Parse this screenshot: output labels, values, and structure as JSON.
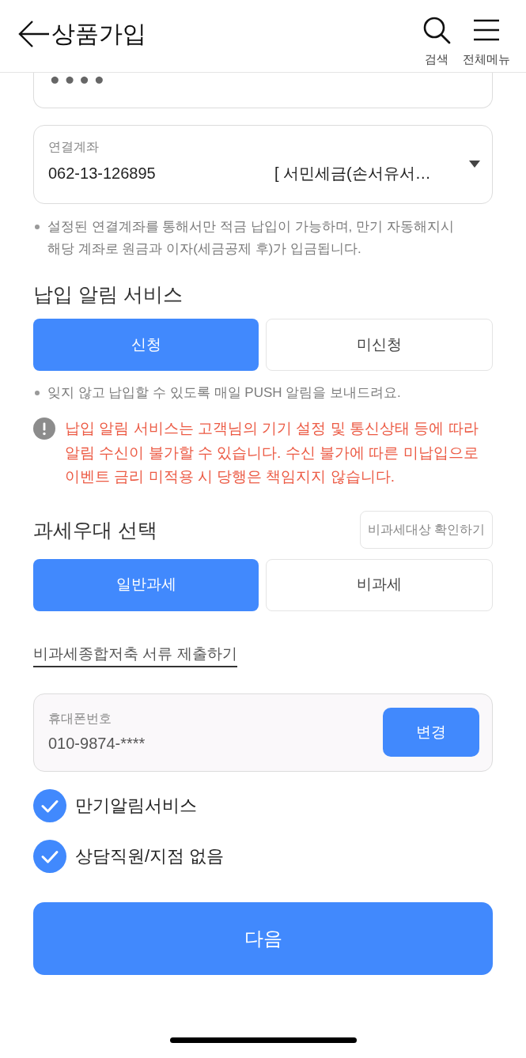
{
  "header": {
    "title": "상품가입",
    "actions": [
      {
        "kind": "search",
        "label": "검색"
      },
      {
        "kind": "menu",
        "label": "전체메뉴"
      }
    ]
  },
  "password_field": {
    "value": "●●●●"
  },
  "account_field": {
    "label": "연결계좌",
    "account_number": "062-13-126895",
    "account_name": "[ 서민세금(손서유서…"
  },
  "account_note": "설정된 연결계좌를 통해서만 적금 납입이 가능하며, 만기 자동해지시 해당 계좌로 원금과 이자(세금공제 후)가 입금됩니다.",
  "payment_alert": {
    "title": "납입 알림 서비스",
    "options": [
      {
        "label": "신청",
        "selected": true
      },
      {
        "label": "미신청",
        "selected": false
      }
    ],
    "note": "잊지 않고 납입할 수 있도록 매일 PUSH 알림을 보내드려요.",
    "warning": "납입 알림 서비스는 고객님의 기기 설정 및 통신상태 등에 따라 알림 수신이 불가할 수 있습니다. 수신 불가에 따른 미납입으로 이벤트 금리 미적용 시 당행은 책임지지 않습니다."
  },
  "tax_benefit": {
    "title": "과세우대 선택",
    "check_button": "비과세대상 확인하기",
    "options": [
      {
        "label": "일반과세",
        "selected": true
      },
      {
        "label": "비과세",
        "selected": false
      }
    ],
    "link": "비과세종합저축 서류 제출하기"
  },
  "phone_field": {
    "label": "휴대폰번호",
    "value": "010-9874-****",
    "button": "변경"
  },
  "agreements": [
    {
      "label": "만기알림서비스",
      "checked": true
    },
    {
      "label": "상담직원/지점 없음",
      "checked": true
    }
  ],
  "next_button": "다음"
}
